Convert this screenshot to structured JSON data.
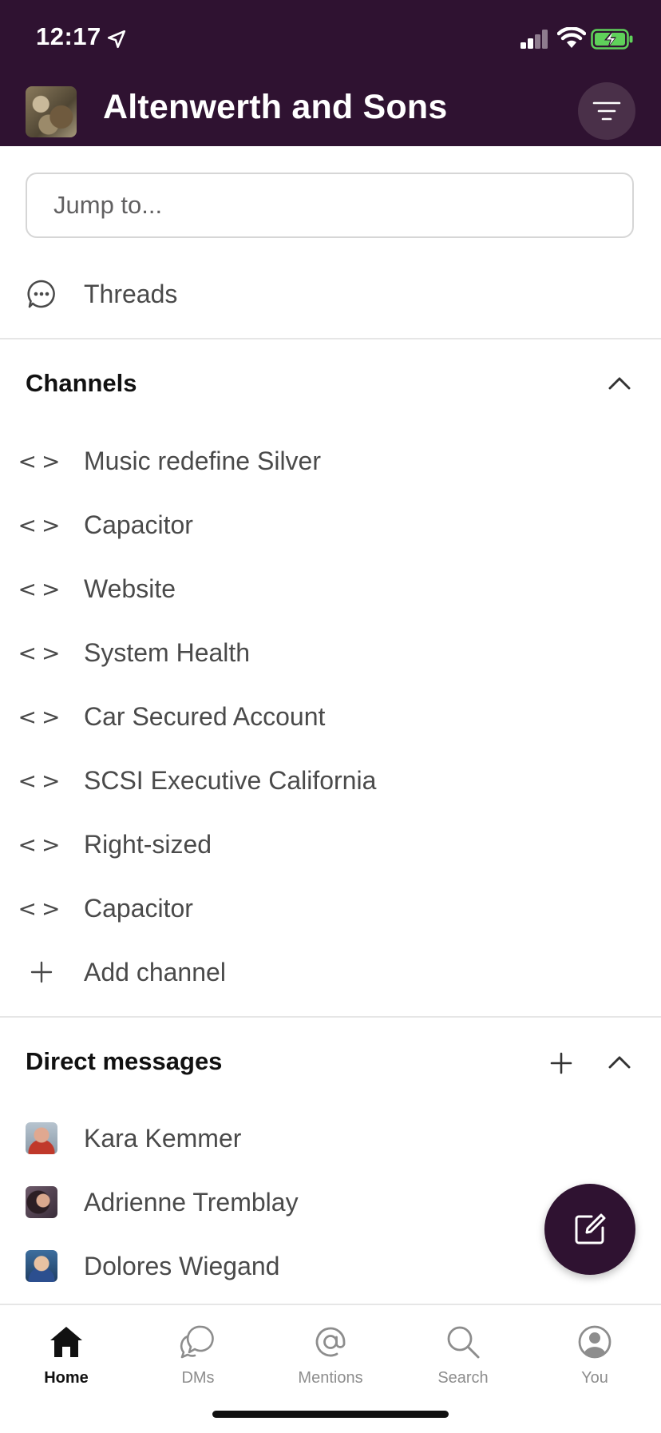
{
  "status_bar": {
    "time": "12:17"
  },
  "header": {
    "workspace_name": "Altenwerth and Sons"
  },
  "jump": {
    "placeholder": "Jump to..."
  },
  "threads": {
    "label": "Threads"
  },
  "channels": {
    "title": "Channels",
    "items": [
      {
        "label": "Music redefine Silver"
      },
      {
        "label": "Capacitor"
      },
      {
        "label": "Website"
      },
      {
        "label": "System Health"
      },
      {
        "label": "Car Secured Account"
      },
      {
        "label": "SCSI Executive California"
      },
      {
        "label": "Right-sized"
      },
      {
        "label": "Capacitor"
      }
    ],
    "add_label": "Add channel"
  },
  "direct_messages": {
    "title": "Direct messages",
    "items": [
      {
        "label": "Kara Kemmer"
      },
      {
        "label": "Adrienne Tremblay"
      },
      {
        "label": "Dolores Wiegand"
      }
    ]
  },
  "tabs": [
    {
      "label": "Home",
      "icon": "home-icon",
      "active": true
    },
    {
      "label": "DMs",
      "icon": "dms-icon",
      "active": false
    },
    {
      "label": "Mentions",
      "icon": "mentions-icon",
      "active": false
    },
    {
      "label": "Search",
      "icon": "search-icon",
      "active": false
    },
    {
      "label": "You",
      "icon": "profile-icon",
      "active": false
    }
  ],
  "colors": {
    "header_bg": "#2f1231",
    "fab_bg": "#2f1231",
    "battery_green": "#5fd15a"
  }
}
